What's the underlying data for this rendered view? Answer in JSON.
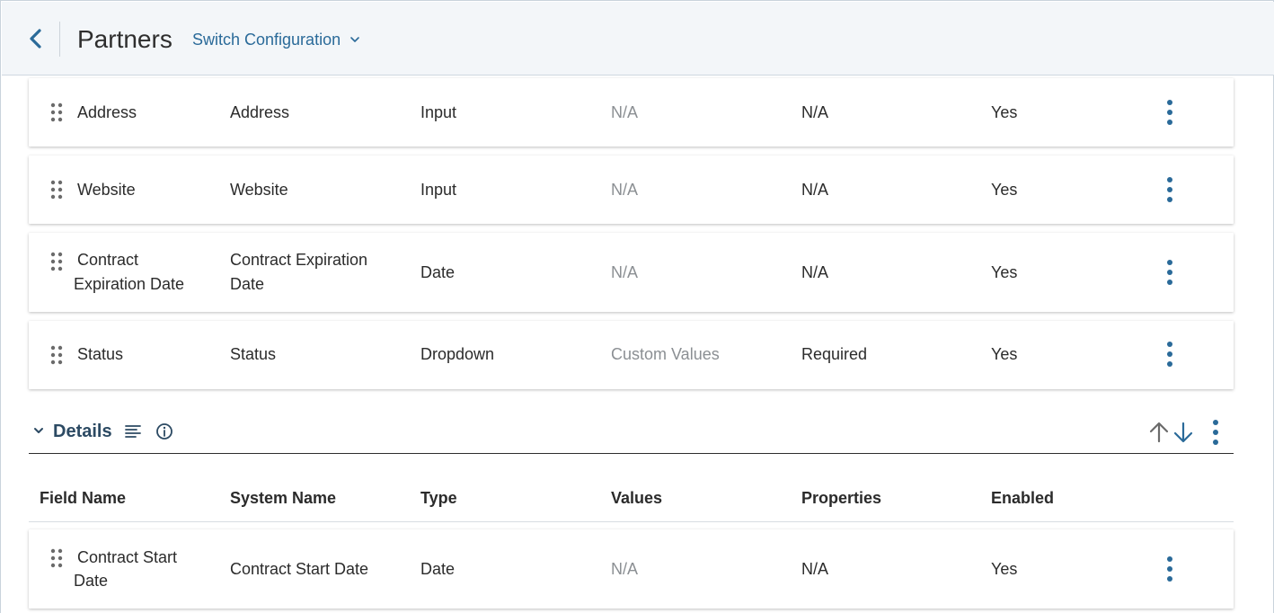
{
  "header": {
    "title": "Partners",
    "switch_label": "Switch Configuration"
  },
  "rows_top": [
    {
      "field": "Address",
      "system": "Address",
      "type": "Input",
      "values": "N/A",
      "properties": "N/A",
      "enabled": "Yes"
    },
    {
      "field": "Website",
      "system": "Website",
      "type": "Input",
      "values": "N/A",
      "properties": "N/A",
      "enabled": "Yes"
    },
    {
      "field_line1": "Contract",
      "field_line2": "Expiration Date",
      "system_line1": "Contract Expiration",
      "system_line2": "Date",
      "type": "Date",
      "values": "N/A",
      "properties": "N/A",
      "enabled": "Yes"
    },
    {
      "field": "Status",
      "system": "Status",
      "type": "Dropdown",
      "values": "Custom Values",
      "properties": "Required",
      "enabled": "Yes"
    }
  ],
  "section": {
    "title": "Details"
  },
  "columns": {
    "field": "Field Name",
    "system": "System Name",
    "type": "Type",
    "values": "Values",
    "properties": "Properties",
    "enabled": "Enabled"
  },
  "rows_details": [
    {
      "field_line1": "Contract Start",
      "field_line2": "Date",
      "system": "Contract Start Date",
      "type": "Date",
      "values": "N/A",
      "properties": "N/A",
      "enabled": "Yes"
    }
  ],
  "icons": {
    "back": "chevron-left-icon",
    "switch_caret": "chevron-down-icon",
    "drag": "drag-handle-icon",
    "kebab": "more-vertical-icon",
    "section_toggle": "chevron-down-icon",
    "section_text": "text-align-icon",
    "section_info": "info-icon",
    "move_up": "arrow-up-icon",
    "move_down": "arrow-down-icon"
  },
  "colors": {
    "accent": "#2a6a99",
    "header_bg": "#f3f6f9",
    "section_title": "#2c4a63",
    "muted_text": "#8b8f93"
  }
}
